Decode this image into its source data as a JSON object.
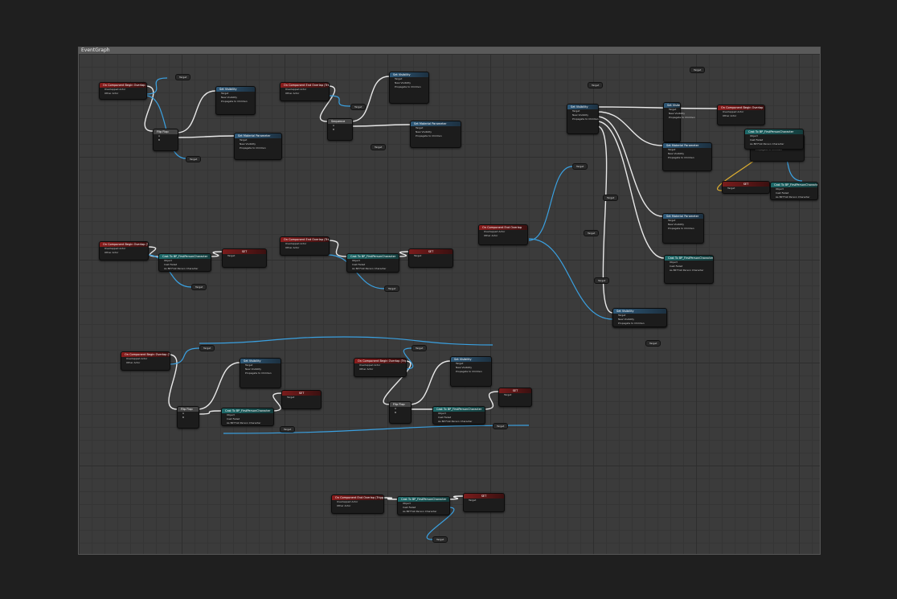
{
  "window": {
    "title": "EventGraph"
  },
  "nodes": [
    {
      "header": "On Component Begin Overlap (TriggerBox)",
      "kind": "event"
    },
    {
      "header": "Set Visibility",
      "kind": "func"
    },
    {
      "header": "Set Material Parameter",
      "kind": "func"
    },
    {
      "header": "Flip Flop",
      "kind": "flow"
    },
    {
      "header": "On Component End Overlap (TriggerBox)",
      "kind": "event"
    },
    {
      "header": "Set Visibility",
      "kind": "func"
    },
    {
      "header": "Set Material Parameter",
      "kind": "func"
    },
    {
      "header": "Sequence",
      "kind": "flow"
    },
    {
      "header": "Set Visibility",
      "kind": "func"
    },
    {
      "header": "Set Material Parameter",
      "kind": "func"
    },
    {
      "header": "On Component Begin Overlap",
      "kind": "event"
    },
    {
      "header": "Set Visibility",
      "kind": "func"
    },
    {
      "header": "Set Material Parameter",
      "kind": "func"
    },
    {
      "header": "Cast To BP_FirstPersonCharacter",
      "kind": "cast"
    },
    {
      "header": "SET",
      "kind": "set"
    },
    {
      "header": "On Component End Overlap",
      "kind": "event"
    },
    {
      "header": "Set Visibility",
      "kind": "func"
    },
    {
      "header": "Timeline",
      "kind": "func"
    },
    {
      "header": "Cast To BP_FirstPersonCharacter",
      "kind": "cast"
    },
    {
      "header": "Cast To BP_FirstPersonCharacter",
      "kind": "cast"
    },
    {
      "header": "SET",
      "kind": "set"
    },
    {
      "header": "On Component Begin Overlap (TriggerBox)",
      "kind": "event"
    },
    {
      "header": "Cast To BP_FirstPersonCharacter",
      "kind": "cast"
    },
    {
      "header": "SET",
      "kind": "set"
    },
    {
      "header": "On Component End Overlap (TriggerBox)",
      "kind": "event"
    },
    {
      "header": "Cast To BP_FirstPersonCharacter",
      "kind": "cast"
    },
    {
      "header": "SET",
      "kind": "set"
    },
    {
      "header": "On Component Begin Overlap (TriggerBox)",
      "kind": "event"
    },
    {
      "header": "Set Visibility",
      "kind": "func"
    },
    {
      "header": "Flip Flop",
      "kind": "flow"
    },
    {
      "header": "Cast To BP_FirstPersonCharacter",
      "kind": "cast"
    },
    {
      "header": "SET",
      "kind": "set"
    },
    {
      "header": "On Component Begin Overlap (TriggerBox)",
      "kind": "event"
    },
    {
      "header": "Set Visibility",
      "kind": "func"
    },
    {
      "header": "Flip Flop",
      "kind": "flow"
    },
    {
      "header": "Cast To BP_FirstPersonCharacter",
      "kind": "cast"
    },
    {
      "header": "SET",
      "kind": "set"
    },
    {
      "header": "On Component End Overlap (TriggerBox)",
      "kind": "event"
    },
    {
      "header": "Cast To BP_FirstPersonCharacter",
      "kind": "cast"
    },
    {
      "header": "SET",
      "kind": "set"
    }
  ],
  "variables": [
    "Target",
    "Target",
    "Target",
    "Target",
    "Target",
    "Target",
    "Target",
    "Target",
    "Target",
    "Target",
    "Target",
    "Target",
    "Target",
    "Target",
    "Target",
    "Target",
    "Target",
    "Target"
  ],
  "labels": {
    "overlap_begin": "On Component Begin Overlap",
    "overlap_end": "On Component End Overlap",
    "target": "Target",
    "new_visibility": "New Visibility",
    "propagate": "Propagate to Children",
    "other_actor": "Other Actor",
    "overlapped": "Overlapped Actor",
    "cast_failed": "Cast Failed",
    "as_bp": "As BP First Person Character",
    "object": "Object"
  }
}
